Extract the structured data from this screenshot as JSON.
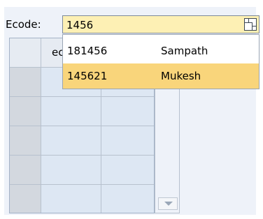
{
  "form": {
    "ecode_label": "Ecode:",
    "ecode_value": "1456"
  },
  "table": {
    "header_partial": "ec"
  },
  "suggestions": {
    "items": [
      {
        "code": "181456",
        "name": "Sampath"
      },
      {
        "code": "145621",
        "name": "Mukesh"
      }
    ]
  },
  "colors": {
    "input_background": "#fdf0b4",
    "highlight_row": "#f9d57b"
  }
}
